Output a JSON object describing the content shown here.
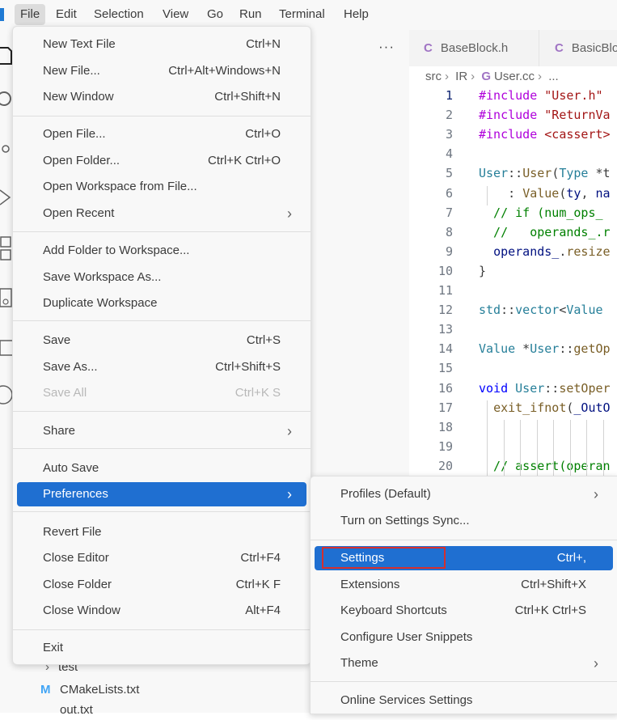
{
  "menubar": {
    "items": [
      "File",
      "Edit",
      "Selection",
      "View",
      "Go",
      "Run",
      "Terminal",
      "Help"
    ],
    "active": "File"
  },
  "explorer": {
    "more_label": "···",
    "tree": [
      {
        "label": "test",
        "chevron": "›"
      },
      {
        "label": "CMakeLists.txt",
        "badge": "M"
      },
      {
        "label": "out.txt"
      }
    ]
  },
  "tabs": [
    {
      "icon": "C",
      "label": "BaseBlock.h"
    },
    {
      "icon": "C",
      "label": "BasicBlo"
    }
  ],
  "breadcrumb": {
    "parts": [
      "src",
      "IR"
    ],
    "file_icon": "G",
    "file": "User.cc",
    "tail": "..."
  },
  "file_menu": {
    "items": [
      {
        "label": "New Text File",
        "shortcut": "Ctrl+N"
      },
      {
        "label": "New File...",
        "shortcut": "Ctrl+Alt+Windows+N"
      },
      {
        "label": "New Window",
        "shortcut": "Ctrl+Shift+N"
      },
      {
        "label": "Open File...",
        "shortcut": "Ctrl+O"
      },
      {
        "label": "Open Folder...",
        "shortcut": "Ctrl+K Ctrl+O"
      },
      {
        "label": "Open Workspace from File...",
        "shortcut": ""
      },
      {
        "label": "Open Recent",
        "shortcut": "",
        "submenu": true
      },
      {
        "label": "Add Folder to Workspace...",
        "shortcut": ""
      },
      {
        "label": "Save Workspace As...",
        "shortcut": ""
      },
      {
        "label": "Duplicate Workspace",
        "shortcut": ""
      },
      {
        "label": "Save",
        "shortcut": "Ctrl+S"
      },
      {
        "label": "Save As...",
        "shortcut": "Ctrl+Shift+S"
      },
      {
        "label": "Save All",
        "shortcut": "Ctrl+K S",
        "disabled": true
      },
      {
        "label": "Share",
        "shortcut": "",
        "submenu": true
      },
      {
        "label": "Auto Save",
        "shortcut": ""
      },
      {
        "label": "Preferences",
        "shortcut": "",
        "submenu": true,
        "highlighted": true
      },
      {
        "label": "Revert File",
        "shortcut": ""
      },
      {
        "label": "Close Editor",
        "shortcut": "Ctrl+F4"
      },
      {
        "label": "Close Folder",
        "shortcut": "Ctrl+K F"
      },
      {
        "label": "Close Window",
        "shortcut": "Alt+F4"
      },
      {
        "label": "Exit",
        "shortcut": ""
      }
    ],
    "submenu_glyph": "›"
  },
  "preferences_menu": {
    "items": [
      {
        "label": "Profiles (Default)",
        "shortcut": "",
        "submenu": true
      },
      {
        "label": "Turn on Settings Sync...",
        "shortcut": ""
      },
      {
        "label": "Settings",
        "shortcut": "Ctrl+,",
        "highlighted": true
      },
      {
        "label": "Extensions",
        "shortcut": "Ctrl+Shift+X"
      },
      {
        "label": "Keyboard Shortcuts",
        "shortcut": "Ctrl+K Ctrl+S"
      },
      {
        "label": "Configure User Snippets",
        "shortcut": ""
      },
      {
        "label": "Theme",
        "shortcut": "",
        "submenu": true
      },
      {
        "label": "Online Services Settings",
        "shortcut": ""
      }
    ]
  },
  "code": {
    "current_line": 1,
    "lines": [
      {
        "n": "1",
        "tokens": [
          [
            "kw",
            "#include "
          ],
          [
            "str",
            "\"User.h\""
          ]
        ]
      },
      {
        "n": "2",
        "tokens": [
          [
            "kw",
            "#include "
          ],
          [
            "str",
            "\"ReturnVa"
          ]
        ]
      },
      {
        "n": "3",
        "tokens": [
          [
            "kw",
            "#include "
          ],
          [
            "str",
            "<cassert>"
          ]
        ]
      },
      {
        "n": "4",
        "tokens": []
      },
      {
        "n": "5",
        "tokens": [
          [
            "typ",
            "User"
          ],
          [
            "plain",
            "::"
          ],
          [
            "fn",
            "User"
          ],
          [
            "plain",
            "("
          ],
          [
            "typ",
            "Type"
          ],
          [
            "plain",
            " *t"
          ]
        ]
      },
      {
        "n": "6",
        "tokens": [
          [
            "plain",
            "    : "
          ],
          [
            "fn",
            "Value"
          ],
          [
            "plain",
            "("
          ],
          [
            "var",
            "ty"
          ],
          [
            "plain",
            ", "
          ],
          [
            "var",
            "na"
          ]
        ]
      },
      {
        "n": "7",
        "tokens": [
          [
            "cm",
            "  // if (num_ops_"
          ]
        ]
      },
      {
        "n": "8",
        "tokens": [
          [
            "cm",
            "  //   operands_.r"
          ]
        ]
      },
      {
        "n": "9",
        "tokens": [
          [
            "plain",
            "  "
          ],
          [
            "var",
            "operands_"
          ],
          [
            "plain",
            "."
          ],
          [
            "fn",
            "resize"
          ]
        ]
      },
      {
        "n": "10",
        "tokens": [
          [
            "plain",
            "}"
          ]
        ]
      },
      {
        "n": "11",
        "tokens": []
      },
      {
        "n": "12",
        "tokens": [
          [
            "typ",
            "std"
          ],
          [
            "plain",
            "::"
          ],
          [
            "typ",
            "vector"
          ],
          [
            "plain",
            "<"
          ],
          [
            "typ",
            "Value"
          ],
          [
            "plain",
            " "
          ]
        ]
      },
      {
        "n": "13",
        "tokens": []
      },
      {
        "n": "14",
        "tokens": [
          [
            "typ",
            "Value"
          ],
          [
            "plain",
            " *"
          ],
          [
            "typ",
            "User"
          ],
          [
            "plain",
            "::"
          ],
          [
            "fn",
            "getOp"
          ]
        ]
      },
      {
        "n": "15",
        "tokens": []
      },
      {
        "n": "16",
        "tokens": [
          [
            "kw2",
            "void"
          ],
          [
            "plain",
            " "
          ],
          [
            "typ",
            "User"
          ],
          [
            "plain",
            "::"
          ],
          [
            "fn",
            "setOper"
          ]
        ]
      },
      {
        "n": "17",
        "tokens": [
          [
            "plain",
            "  "
          ],
          [
            "fn",
            "exit_ifnot"
          ],
          [
            "plain",
            "("
          ],
          [
            "var",
            "_OutO"
          ]
        ]
      },
      {
        "n": "18",
        "tokens": []
      },
      {
        "n": "19",
        "tokens": []
      },
      {
        "n": "20",
        "tokens": [
          [
            "cm",
            "  // assert(operan"
          ]
        ]
      }
    ]
  },
  "edge_fragments": [
    "s",
    "I",
    "s"
  ],
  "colors": {
    "accent": "#1f6fd1",
    "annotation_box": "#d32f2f",
    "menu_bg": "#f8f8f8"
  },
  "icons": [
    "files-icon",
    "search-icon",
    "source-control-icon",
    "run-debug-icon",
    "extensions-icon",
    "remote-icon",
    "testing-icon",
    "chatgpt-icon"
  ]
}
